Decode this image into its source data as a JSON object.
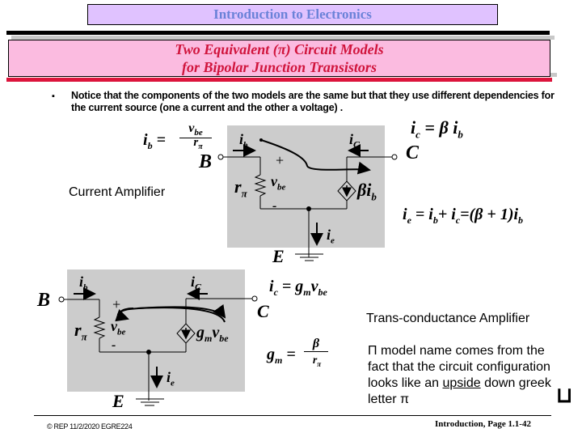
{
  "header": {
    "course_title": "Introduction to Electronics",
    "slide_title_line1": "Two Equivalent (π) Circuit Models",
    "slide_title_line2": "for Bipolar Junction Transistors"
  },
  "bullet": {
    "marker": "▪",
    "text": "Notice that the components of the two models are the same but that they use different dependencies for the current source (one a current and the other a voltage) ."
  },
  "current_amplifier": {
    "label": "Current Amplifier",
    "eq_ib_lhs": "i",
    "eq_ib_lhs_sub": "b",
    "eq_ib_num": "v",
    "eq_ib_num_sub": "be",
    "eq_ib_den": "r",
    "eq_ib_den_sub": "π",
    "eq_ic": "i",
    "eq_ic_sub": "c",
    "eq_ic_rhs": "= β i",
    "eq_ic_rhs_sub": "b",
    "eq_ie": "i",
    "eq_ie_sub": "e",
    "eq_ie_mid1": " = i",
    "eq_ie_mid1_sub": "b",
    "eq_ie_mid2": "+ i",
    "eq_ie_mid2_sub": "c",
    "eq_ie_rhs": "=(β + 1)i",
    "eq_ie_rhs_sub": "b",
    "node_b": "B",
    "node_c": "C",
    "node_e": "E",
    "ib_label": "i",
    "ib_sub": "b",
    "ic_label": "i",
    "ic_sub": "C",
    "ie_label": "i",
    "ie_sub": "e",
    "r_label": "r",
    "r_sub": "π",
    "v_label": "v",
    "v_sub": "be",
    "plus": "+",
    "minus": "-",
    "source_label": "βi",
    "source_sub": "b"
  },
  "transconductance_amplifier": {
    "label": "Trans-conductance Amplifier",
    "eq_ic": "i",
    "eq_ic_sub": "c",
    "eq_ic_rhs": "= g",
    "eq_ic_rhs_sub": "m",
    "eq_ic_rhs2": "v",
    "eq_ic_rhs2_sub": "be",
    "eq_gm": "g",
    "eq_gm_sub": "m",
    "eq_gm_num": "β",
    "eq_gm_den": "r",
    "eq_gm_den_sub": "π",
    "node_b": "B",
    "node_c": "C",
    "node_e": "E",
    "ib_label": "i",
    "ib_sub": "b",
    "ic_label": "i",
    "ic_sub": "C",
    "ie_label": "i",
    "ie_sub": "e",
    "r_label": "r",
    "r_sub": "π",
    "v_label": "v",
    "v_sub": "be",
    "plus": "+",
    "minus": "-",
    "source_label": "g",
    "source_sub": "m",
    "source_label2": "v",
    "source_sub2": "be"
  },
  "notes": {
    "line1": "Π model name comes from the fact that the circuit configuration looks like an",
    "underlined": "upside",
    "line2": " down greek letter π",
    "glyph": "⊔"
  },
  "footer": {
    "left": "© REP  11/2/2020  EGRE224",
    "right": "Introduction, Page 1.1-42"
  }
}
